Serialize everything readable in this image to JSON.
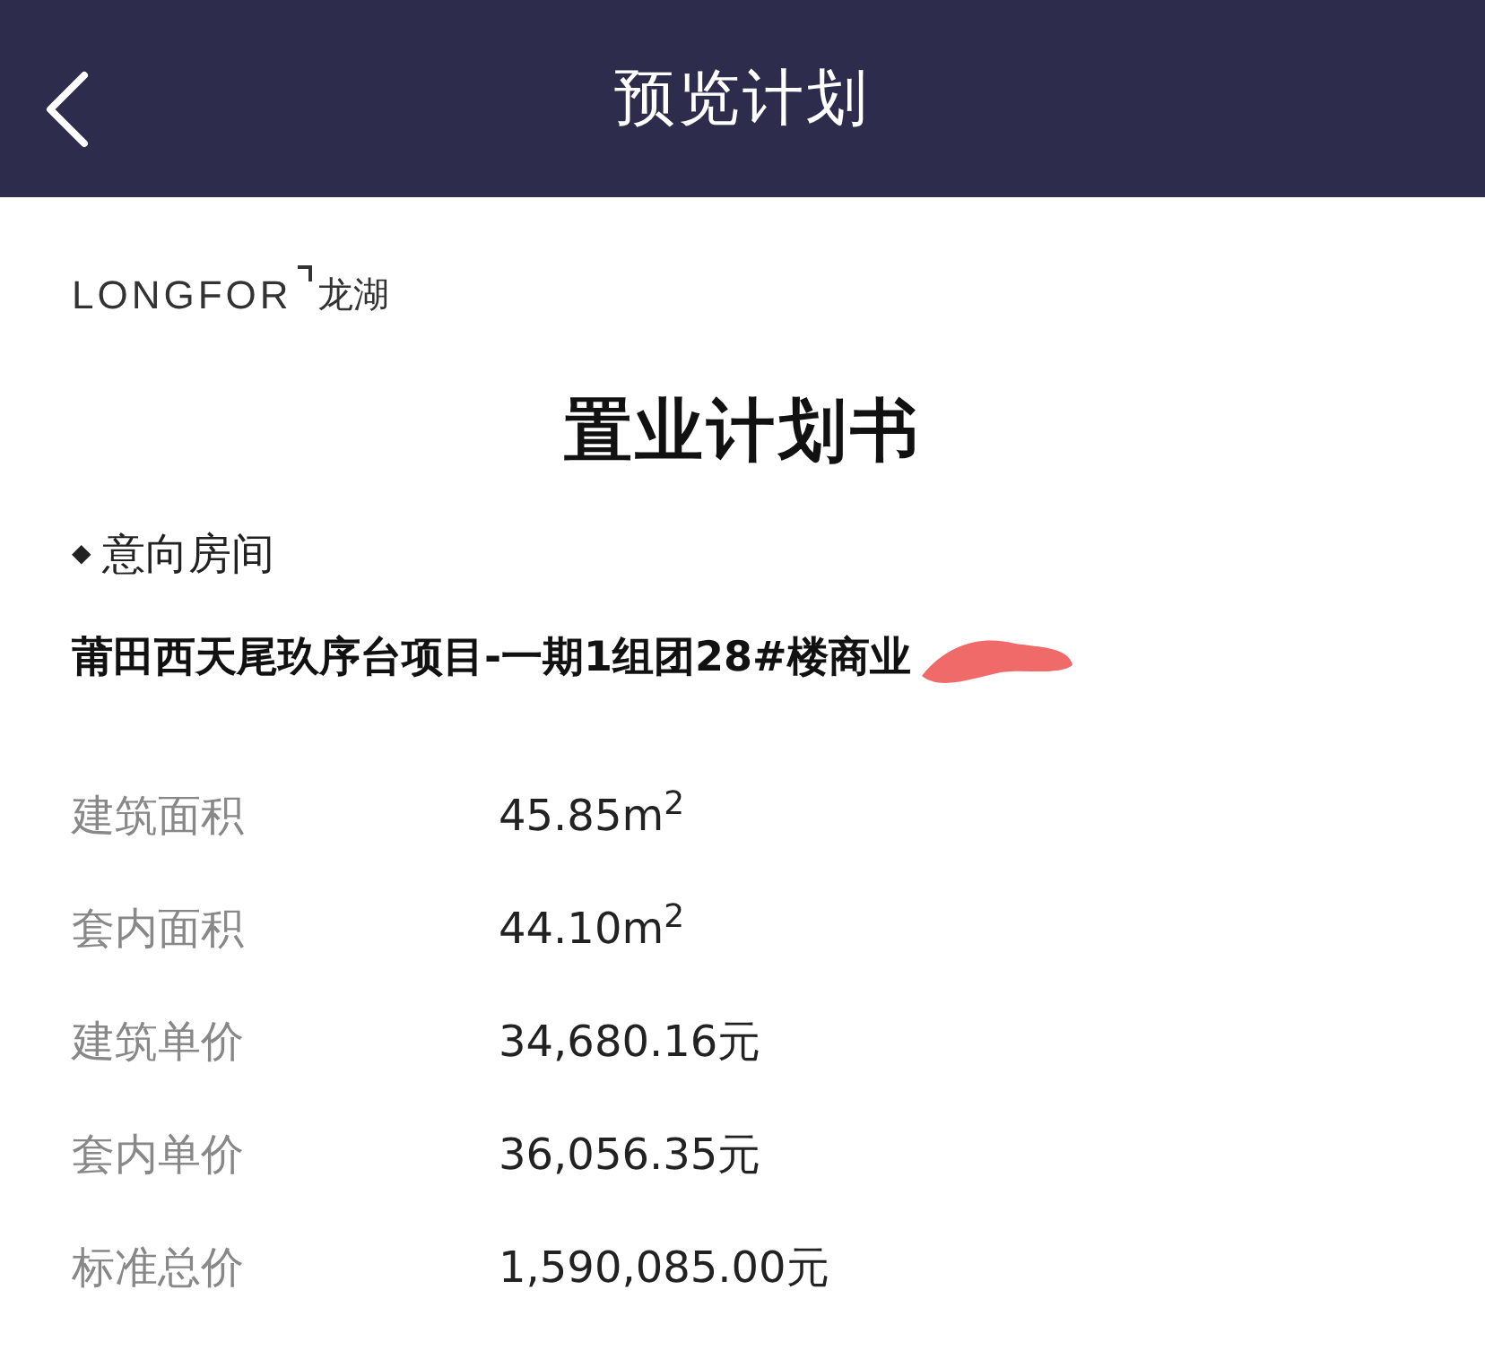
{
  "header": {
    "title": "预览计划"
  },
  "logo": {
    "latin": "LONGFOR",
    "chinese": "龙湖"
  },
  "document": {
    "title": "置业计划书",
    "section": {
      "marker": "◆",
      "label": "意向房间"
    },
    "room": "莆田西天尾玖序台项目-一期1组团28#楼商业",
    "rows": [
      {
        "label": "建筑面积",
        "value": "45.85m$^{2}$"
      },
      {
        "label": "套内面积",
        "value": "44.10m$^{2}$"
      },
      {
        "label": "建筑单价",
        "value": "34,680.16元"
      },
      {
        "label": "套内单价",
        "value": "36,056.35元"
      },
      {
        "label": "标准总价",
        "value": "1,590,085.00元"
      }
    ]
  }
}
